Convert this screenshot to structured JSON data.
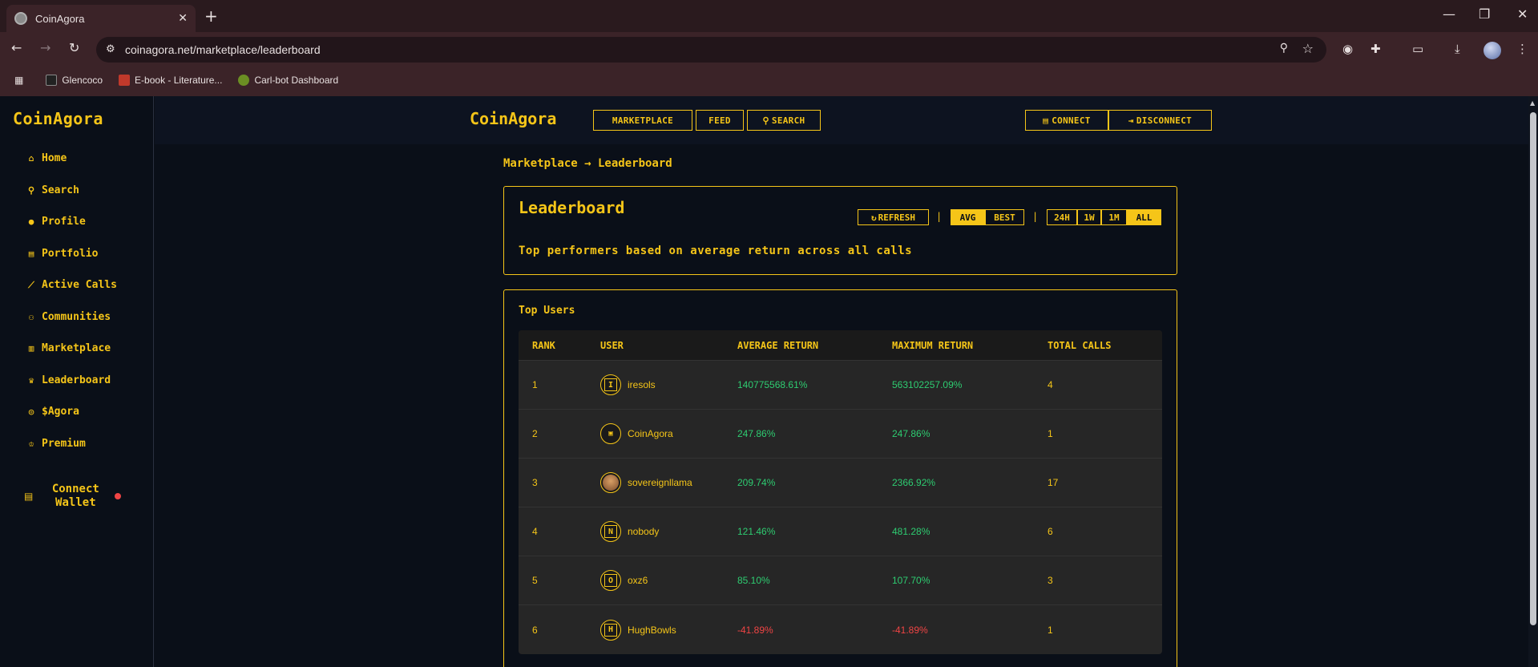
{
  "browser": {
    "tab_title": "CoinAgora",
    "url": "coinagora.net/marketplace/leaderboard",
    "bookmarks": [
      {
        "label": "Glencoco",
        "color": "#222222"
      },
      {
        "label": "E-book - Literature...",
        "color": "#c0392b"
      },
      {
        "label": "Carl-bot Dashboard",
        "color": "#6b8e23"
      }
    ]
  },
  "sidebar": {
    "brand": "CoinAgora",
    "items": [
      {
        "label": "Home",
        "icon": "house-icon",
        "glyph": "⌂"
      },
      {
        "label": "Search",
        "icon": "search-icon",
        "glyph": "⚲"
      },
      {
        "label": "Profile",
        "icon": "user-icon",
        "glyph": "●"
      },
      {
        "label": "Portfolio",
        "icon": "wallet-icon",
        "glyph": "▤"
      },
      {
        "label": "Active Calls",
        "icon": "chart-line-icon",
        "glyph": "⟋"
      },
      {
        "label": "Communities",
        "icon": "users-icon",
        "glyph": "⚇"
      },
      {
        "label": "Marketplace",
        "icon": "store-icon",
        "glyph": "▥"
      },
      {
        "label": "Leaderboard",
        "icon": "trophy-icon",
        "glyph": "♛"
      },
      {
        "label": "$Agora",
        "icon": "coins-icon",
        "glyph": "◎"
      },
      {
        "label": "Premium",
        "icon": "crown-icon",
        "glyph": "♔"
      }
    ],
    "connect_wallet": "Connect Wallet"
  },
  "topbar": {
    "brand": "CoinAgora",
    "marketplace": "MARKETPLACE",
    "feed": "FEED",
    "search": "SEARCH",
    "connect": "CONNECT",
    "disconnect": "DISCONNECT"
  },
  "breadcrumb": "Marketplace → Leaderboard",
  "leaderboard": {
    "title": "Leaderboard",
    "description": "Top performers based on average return across all calls",
    "refresh": "REFRESH",
    "metric_options": [
      "AVG",
      "BEST"
    ],
    "metric_selected": "AVG",
    "time_options": [
      "24H",
      "1W",
      "1M",
      "ALL"
    ],
    "time_selected": "ALL"
  },
  "top_users": {
    "title": "Top Users",
    "columns": [
      "RANK",
      "USER",
      "AVERAGE RETURN",
      "MAXIMUM RETURN",
      "TOTAL CALLS"
    ],
    "rows": [
      {
        "rank": "1",
        "user": "iresols",
        "avatar": "I",
        "avg": "140775568.61%",
        "max": "563102257.09%",
        "calls": "4",
        "sign": "pos"
      },
      {
        "rank": "2",
        "user": "CoinAgora",
        "avatar": "",
        "avg": "247.86%",
        "max": "247.86%",
        "calls": "1",
        "sign": "pos"
      },
      {
        "rank": "3",
        "user": "sovereignllama",
        "avatar": "",
        "avg": "209.74%",
        "max": "2366.92%",
        "calls": "17",
        "sign": "pos"
      },
      {
        "rank": "4",
        "user": "nobody",
        "avatar": "N",
        "avg": "121.46%",
        "max": "481.28%",
        "calls": "6",
        "sign": "pos"
      },
      {
        "rank": "5",
        "user": "oxz6",
        "avatar": "O",
        "avg": "85.10%",
        "max": "107.70%",
        "calls": "3",
        "sign": "pos"
      },
      {
        "rank": "6",
        "user": "HughBowls",
        "avatar": "H",
        "avg": "-41.89%",
        "max": "-41.89%",
        "calls": "1",
        "sign": "neg"
      }
    ]
  },
  "colors": {
    "accent": "#f5c518",
    "positive": "#2ecc71",
    "negative": "#ef4444",
    "background": "#0a0f18"
  }
}
